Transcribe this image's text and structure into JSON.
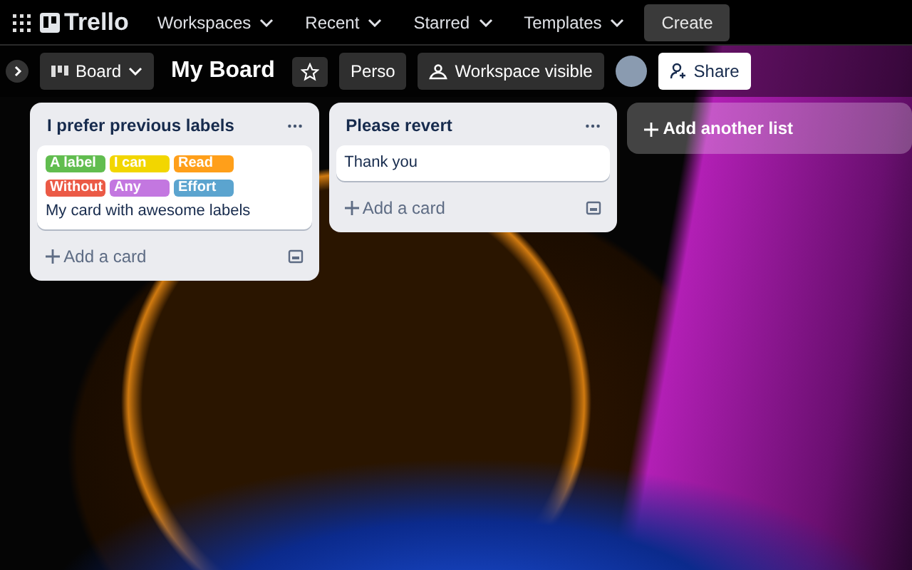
{
  "top_nav": {
    "logo": "Trello",
    "menus": [
      "Workspaces",
      "Recent",
      "Starred",
      "Templates"
    ],
    "create": "Create"
  },
  "board_header": {
    "view": "Board",
    "title": "My Board",
    "starred": false,
    "workspace": "Perso",
    "visibility": "Workspace visible",
    "share": "Share"
  },
  "lists": [
    {
      "title": "I prefer previous labels",
      "cards": [
        {
          "labels": [
            {
              "text": "A label",
              "color": "#61bd4f"
            },
            {
              "text": "I can",
              "color": "#f2d600"
            },
            {
              "text": "Read",
              "color": "#ff9f1a"
            },
            {
              "text": "Without",
              "color": "#eb5a46"
            },
            {
              "text": "Any",
              "color": "#c377e0"
            },
            {
              "text": "Effort",
              "color": "#5ba4cf"
            }
          ],
          "title": "My card with awesome labels"
        }
      ],
      "add_card": "Add a card"
    },
    {
      "title": "Please revert",
      "cards": [
        {
          "title": "Thank you"
        }
      ],
      "add_card": "Add a card"
    }
  ],
  "add_list": "Add another list"
}
